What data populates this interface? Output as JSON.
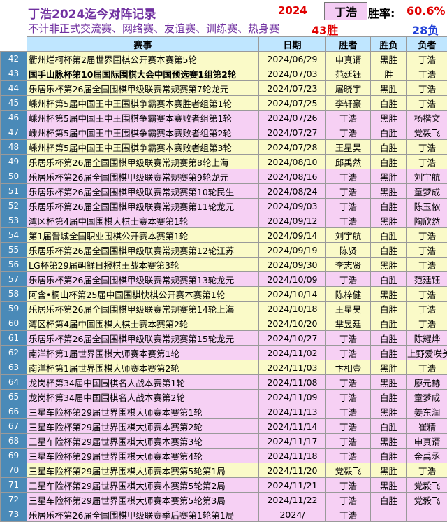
{
  "header": {
    "title": "丁浩2024迄今对阵记录",
    "subtitle": "不计非正式交流赛、网络赛、友谊赛、训练赛、热身赛",
    "year": "2024",
    "player": "丁浩",
    "rate_label": "胜率:",
    "rate_value": "60.6%",
    "wins": "43胜",
    "losses": "28负"
  },
  "columns": [
    "",
    "赛事",
    "日期",
    "胜者",
    "胜负",
    "负者"
  ],
  "colors": {
    "yellow_row": "#fafac8",
    "pink_row": "#f6d0f4",
    "header_row": "#bfe6ff",
    "number_col": "#4a8ab8"
  },
  "rows": [
    {
      "n": "42",
      "event": "衢州烂柯杯第2届世界围棋公开赛本赛第5轮",
      "date": "2024/06/29",
      "winner": "申真谞",
      "result": "黑胜",
      "loser": "丁浩",
      "color": "yellow",
      "bold": false
    },
    {
      "n": "43",
      "event": "国手山脉杯第10届国际围棋大会中国预选赛1组第2轮",
      "date": "2024/07/03",
      "winner": "范廷钰",
      "result": "胜",
      "loser": "丁浩",
      "color": "yellow",
      "bold": true
    },
    {
      "n": "44",
      "event": "乐居乐杯第26届全国围棋甲级联赛常规赛第7轮龙元",
      "date": "2024/07/23",
      "winner": "屠晓宇",
      "result": "黑胜",
      "loser": "丁浩",
      "color": "yellow",
      "bold": false
    },
    {
      "n": "45",
      "event": "嵊州杯第5届中国王中王围棋争霸赛本赛胜者组第1轮",
      "date": "2024/07/25",
      "winner": "李轩豪",
      "result": "白胜",
      "loser": "丁浩",
      "color": "yellow",
      "bold": false
    },
    {
      "n": "46",
      "event": "嵊州杯第5届中国王中王围棋争霸赛本赛败者组第1轮",
      "date": "2024/07/26",
      "winner": "丁浩",
      "result": "黑胜",
      "loser": "杨楷文",
      "color": "pink",
      "bold": false
    },
    {
      "n": "47",
      "event": "嵊州杯第5届中国王中王围棋争霸赛本赛败者组第2轮",
      "date": "2024/07/27",
      "winner": "丁浩",
      "result": "白胜",
      "loser": "党毅飞",
      "color": "pink",
      "bold": false
    },
    {
      "n": "48",
      "event": "嵊州杯第5届中国王中王围棋争霸赛本赛败者组第3轮",
      "date": "2024/07/28",
      "winner": "王星昊",
      "result": "白胜",
      "loser": "丁浩",
      "color": "yellow",
      "bold": false
    },
    {
      "n": "49",
      "event": "乐居乐杯第26届全国围棋甲级联赛常规赛第8轮上海",
      "date": "2024/08/10",
      "winner": "邱禹然",
      "result": "白胜",
      "loser": "丁浩",
      "color": "yellow",
      "bold": false
    },
    {
      "n": "50",
      "event": "乐居乐杯第26届全国围棋甲级联赛常规赛第9轮龙元",
      "date": "2024/08/16",
      "winner": "丁浩",
      "result": "黑胜",
      "loser": "刘宇航",
      "color": "pink",
      "bold": false
    },
    {
      "n": "51",
      "event": "乐居乐杯第26届全国围棋甲级联赛常规赛第10轮民生",
      "date": "2024/08/24",
      "winner": "丁浩",
      "result": "黑胜",
      "loser": "童梦成",
      "color": "pink",
      "bold": false
    },
    {
      "n": "52",
      "event": "乐居乐杯第26届全国围棋甲级联赛常规赛第11轮龙元",
      "date": "2024/09/03",
      "winner": "丁浩",
      "result": "白胜",
      "loser": "陈玉侬",
      "color": "pink",
      "bold": false
    },
    {
      "n": "53",
      "event": "湾区杯第4届中国围棋大棋士赛本赛第1轮",
      "date": "2024/09/12",
      "winner": "丁浩",
      "result": "黑胜",
      "loser": "陶欣然",
      "color": "pink",
      "bold": false
    },
    {
      "n": "54",
      "event": "第1届晋城全国职业围棋公开赛本赛第1轮",
      "date": "2024/09/14",
      "winner": "刘宇航",
      "result": "白胜",
      "loser": "丁浩",
      "color": "yellow",
      "bold": false
    },
    {
      "n": "55",
      "event": "乐居乐杯第26届全国围棋甲级联赛常规赛第12轮江苏",
      "date": "2024/09/19",
      "winner": "陈贤",
      "result": "白胜",
      "loser": "丁浩",
      "color": "yellow",
      "bold": false
    },
    {
      "n": "56",
      "event": "LG杯第29届朝鲜日报棋王战本赛第3轮",
      "date": "2024/09/30",
      "winner": "李志贤",
      "result": "黑胜",
      "loser": "丁浩",
      "color": "yellow",
      "bold": false
    },
    {
      "n": "57",
      "event": "乐居乐杯第26届全国围棋甲级联赛常规赛第13轮龙元",
      "date": "2024/10/09",
      "winner": "丁浩",
      "result": "白胜",
      "loser": "范廷钰",
      "color": "pink",
      "bold": false
    },
    {
      "n": "58",
      "event": "阿含•桐山杯第25届中国围棋快棋公开赛本赛第1轮",
      "date": "2024/10/14",
      "winner": "陈梓健",
      "result": "黑胜",
      "loser": "丁浩",
      "color": "yellow",
      "bold": false
    },
    {
      "n": "59",
      "event": "乐居乐杯第26届全国围棋甲级联赛常规赛第14轮上海",
      "date": "2024/10/18",
      "winner": "王星昊",
      "result": "白胜",
      "loser": "丁浩",
      "color": "yellow",
      "bold": false
    },
    {
      "n": "60",
      "event": "湾区杯第4届中国围棋大棋士赛本赛第2轮",
      "date": "2024/10/20",
      "winner": "芈昱廷",
      "result": "白胜",
      "loser": "丁浩",
      "color": "yellow",
      "bold": false
    },
    {
      "n": "61",
      "event": "乐居乐杯第26届全国围棋甲级联赛常规赛第15轮龙元",
      "date": "2024/10/27",
      "winner": "丁浩",
      "result": "白胜",
      "loser": "陈耀烨",
      "color": "pink",
      "bold": false
    },
    {
      "n": "62",
      "event": "南洋杯第1届世界围棋大师赛本赛第1轮",
      "date": "2024/11/02",
      "winner": "丁浩",
      "result": "白胜",
      "loser": "上野爱咲美",
      "color": "pink",
      "bold": false
    },
    {
      "n": "63",
      "event": "南洋杯第1届世界围棋大师赛本赛第2轮",
      "date": "2024/11/03",
      "winner": "卞相壹",
      "result": "黑胜",
      "loser": "丁浩",
      "color": "yellow",
      "bold": false
    },
    {
      "n": "64",
      "event": "龙岗杯第34届中国围棋名人战本赛第1轮",
      "date": "2024/11/08",
      "winner": "丁浩",
      "result": "黑胜",
      "loser": "廖元赫",
      "color": "pink",
      "bold": false
    },
    {
      "n": "65",
      "event": "龙岗杯第34届中国围棋名人战本赛第2轮",
      "date": "2024/11/09",
      "winner": "丁浩",
      "result": "白胜",
      "loser": "童梦成",
      "color": "pink",
      "bold": false
    },
    {
      "n": "66",
      "event": "三星车险杯第29届世界围棋大师赛本赛第1轮",
      "date": "2024/11/13",
      "winner": "丁浩",
      "result": "黑胜",
      "loser": "姜东润",
      "color": "pink",
      "bold": false
    },
    {
      "n": "67",
      "event": "三星车险杯第29届世界围棋大师赛本赛第2轮",
      "date": "2024/11/14",
      "winner": "丁浩",
      "result": "白胜",
      "loser": "崔精",
      "color": "pink",
      "bold": false
    },
    {
      "n": "68",
      "event": "三星车险杯第29届世界围棋大师赛本赛第3轮",
      "date": "2024/11/17",
      "winner": "丁浩",
      "result": "黑胜",
      "loser": "申真谞",
      "color": "pink",
      "bold": false
    },
    {
      "n": "69",
      "event": "三星车险杯第29届世界围棋大师赛本赛第4轮",
      "date": "2024/11/18",
      "winner": "丁浩",
      "result": "白胜",
      "loser": "金禹丞",
      "color": "pink",
      "bold": false
    },
    {
      "n": "70",
      "event": "三星车险杯第29届世界围棋大师赛本赛第5轮第1局",
      "date": "2024/11/20",
      "winner": "党毅飞",
      "result": "黑胜",
      "loser": "丁浩",
      "color": "yellow",
      "bold": false
    },
    {
      "n": "71",
      "event": "三星车险杯第29届世界围棋大师赛本赛第5轮第2局",
      "date": "2024/11/21",
      "winner": "丁浩",
      "result": "黑胜",
      "loser": "党毅飞",
      "color": "pink",
      "bold": false
    },
    {
      "n": "72",
      "event": "三星车险杯第29届世界围棋大师赛本赛第5轮第3局",
      "date": "2024/11/22",
      "winner": "丁浩",
      "result": "白胜",
      "loser": "党毅飞",
      "color": "pink",
      "bold": false
    },
    {
      "n": "73",
      "event": "乐居乐杯第26届全国围棋甲级联赛季后赛第1轮第1局",
      "date": "2024/",
      "winner": "丁浩",
      "result": "",
      "loser": "",
      "color": "pink",
      "bold": false
    }
  ]
}
